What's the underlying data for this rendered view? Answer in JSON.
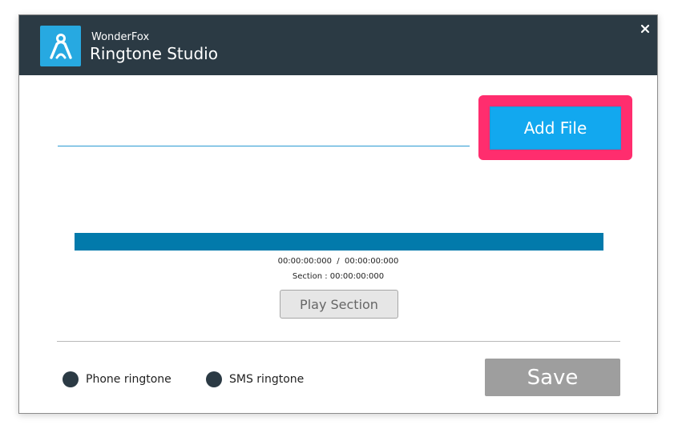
{
  "app": {
    "brand": "WonderFox",
    "title": "Ringtone Studio",
    "logo_icon": "ringtone-figure-icon",
    "close_icon": "close-icon"
  },
  "file": {
    "path_value": "",
    "add_file_label": "Add File"
  },
  "player": {
    "time_readout": "00:00:00:000  /  00:00:00:000",
    "section_readout": "Section : 00:00:00:000",
    "play_section_label": "Play Section"
  },
  "ringtone_type": {
    "options": [
      {
        "label": "Phone ringtone"
      },
      {
        "label": "SMS ringtone"
      }
    ]
  },
  "actions": {
    "save_label": "Save"
  },
  "colors": {
    "titlebar": "#2b3a44",
    "logo": "#27a9e1",
    "accent": "#12a8ef",
    "highlight": "#ff2d6e",
    "wave_bar": "#027aab",
    "save_disabled": "#9e9e9e"
  }
}
